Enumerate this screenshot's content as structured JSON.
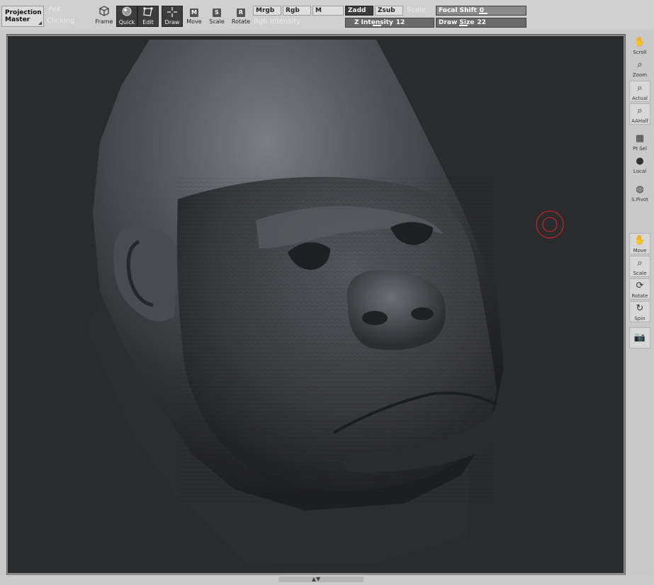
{
  "toolbar": {
    "projection_master": [
      "Projection",
      "Master"
    ],
    "ghost_left_top": "PeK",
    "ghost_left_bottom": "Clicking",
    "ghost_mid": "Rgb Intensity",
    "ghost_scale": "Scale",
    "tools": [
      {
        "label": "Frame",
        "icon": "cube-icon",
        "active": false
      },
      {
        "label": "Quick",
        "icon": "quick-sphere-icon",
        "active": true
      },
      {
        "label": "Edit",
        "icon": "edit-icon",
        "active": true
      },
      {
        "label": "Draw",
        "icon": "draw-icon",
        "active": true
      },
      {
        "label": "Move",
        "icon": "M",
        "active": false
      },
      {
        "label": "Scale",
        "icon": "S",
        "active": false
      },
      {
        "label": "Rotate",
        "icon": "R",
        "active": false
      }
    ],
    "channels": {
      "mrgb": "Mrgb",
      "rgb": "Rgb",
      "m": "M",
      "zadd": "Zadd",
      "zsub": "Zsub"
    },
    "z_intensity": {
      "label": "Z Intensity",
      "value": "12"
    },
    "focal_shift": {
      "label": "Focal Shift",
      "value": "0"
    },
    "draw_size": {
      "label": "Draw Size",
      "value": "22"
    }
  },
  "shelf": [
    {
      "label": "Scroll",
      "icon": "hand-icon"
    },
    {
      "label": "Zoom",
      "icon": "zoom-icon"
    },
    {
      "label": "Actual",
      "icon": "actual-icon"
    },
    {
      "label": "AAHalf",
      "icon": "aahalf-icon"
    },
    {
      "label": "Pt Sel",
      "icon": "grid-icon"
    },
    {
      "label": "Local",
      "icon": "local-icon"
    },
    {
      "label": "S.Pivot",
      "icon": "pivot-icon"
    },
    {
      "label": "Move",
      "icon": "hand-icon"
    },
    {
      "label": "Scale",
      "icon": "zoom-icon"
    },
    {
      "label": "Rotate",
      "icon": "rotate-icon"
    },
    {
      "label": "Spin",
      "icon": "spin-icon"
    },
    {
      "label": "",
      "icon": "camera-icon"
    }
  ],
  "colors": {
    "canvas_bg": "#2a2b2d",
    "active_button": "#3d3d3d",
    "slider": "#6a6a6a",
    "brush_cursor": "#c0262b"
  }
}
